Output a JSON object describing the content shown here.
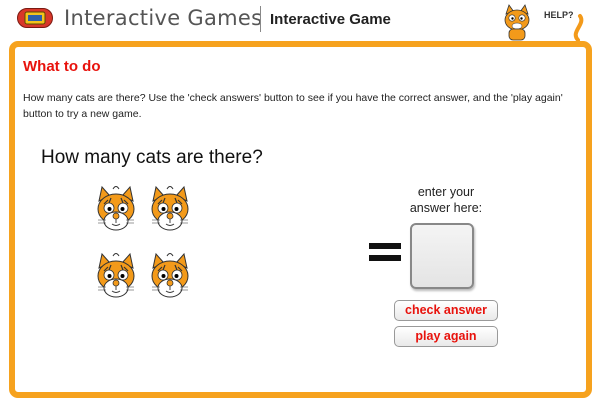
{
  "header": {
    "app_title": "Interactive Games",
    "subtitle": "Interactive Game",
    "help_label": "HELP?",
    "logo_icon": "game-console-icon",
    "help_icon": "cat-mascot-icon"
  },
  "panel": {
    "heading": "What to do",
    "instructions": "How many cats are there? Use the 'check answers' button to see if you have the correct answer, and the 'play again' button to try a new game.",
    "question": "How many cats are there?",
    "cat_count": 4,
    "cat_icon": "cat-face-icon",
    "answer_label_line1": "enter your",
    "answer_label_line2": "answer here:",
    "answer_value": "",
    "check_button": "check answer",
    "play_button": "play again"
  },
  "colors": {
    "frame": "#f6a21e",
    "heading": "#e8120c",
    "button_text": "#e8120c",
    "cat_orange": "#f39a1a"
  }
}
